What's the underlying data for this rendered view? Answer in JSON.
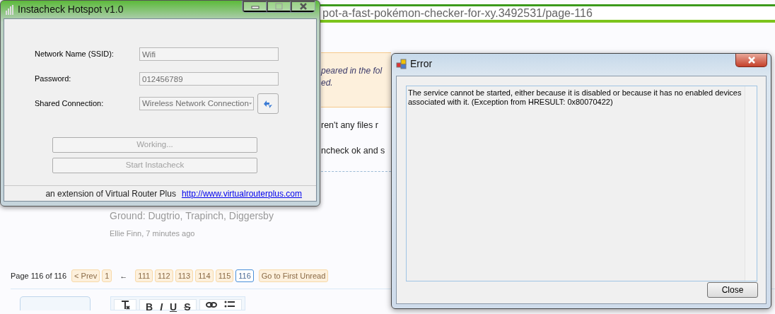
{
  "browser": {
    "address": "pot-a-fast-pokémon-checker-for-xy.3492531/page-116"
  },
  "page": {
    "notice_lines": [
      "peared in the fol",
      "ed."
    ],
    "lines": [
      "ren't any files r",
      "ncheck ok and s"
    ],
    "post": {
      "lines": [
        "Ground: Dugtrio, Trapinch, Diggersby"
      ],
      "meta": "Ellie Finn, 7 minutes ago"
    },
    "pagination": {
      "label": "Page 116 of 116",
      "prev": "< Prev",
      "items": [
        {
          "kind": "page",
          "label": "1",
          "selected": false
        },
        {
          "kind": "gap",
          "label": "←"
        },
        {
          "kind": "page",
          "label": "111",
          "selected": false
        },
        {
          "kind": "page",
          "label": "112",
          "selected": false
        },
        {
          "kind": "page",
          "label": "113",
          "selected": false
        },
        {
          "kind": "page",
          "label": "114",
          "selected": false
        },
        {
          "kind": "page",
          "label": "115",
          "selected": false
        },
        {
          "kind": "page",
          "label": "116",
          "selected": true
        }
      ],
      "first_unread": "Go to First Unread"
    },
    "editor_toolbar": {
      "buttons": [
        "B",
        "I",
        "U",
        "S"
      ]
    }
  },
  "instacheck": {
    "title": "Instacheck Hotspot v1.0",
    "fields": [
      {
        "kind": "text",
        "label": "Network Name (SSID):",
        "value": "Wifi",
        "disabled": true
      },
      {
        "kind": "text",
        "label": "Password:",
        "value": "012456789",
        "disabled": true
      },
      {
        "kind": "combo",
        "label": "Shared Connection:",
        "value": "Wireless Network Connection",
        "disabled": true
      }
    ],
    "buttons": [
      {
        "label": "Working...",
        "disabled": true
      },
      {
        "label": "Start Instacheck",
        "disabled": true
      }
    ],
    "status": {
      "text": "an extension of Virtual Router Plus",
      "link": "http://www.virtualrouterplus.com"
    }
  },
  "error": {
    "title": "Error",
    "message": "The service cannot be started, either because it is disabled or because it has no enabled devices associated with it. (Exception from HRESULT: 0x80070422)",
    "buttons": [
      "Close"
    ]
  }
}
